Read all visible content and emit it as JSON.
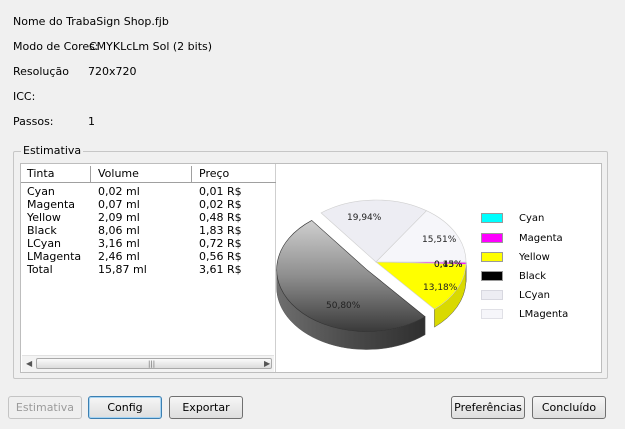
{
  "info": {
    "name_label": "Nome do TrabaSign Shop.fjb",
    "mode_label": "Modo de Cores:",
    "mode_value": "CMYKLcLm Sol (2 bits)",
    "resolution_label": "Resolução",
    "resolution_value": "720x720",
    "icc_label": "ICC:",
    "passes_label": "Passos:",
    "passes_value": "1"
  },
  "group": {
    "title": "Estimativa"
  },
  "table": {
    "headers": [
      "Tinta",
      "Volume",
      "Preço"
    ],
    "rows": [
      [
        "Cyan",
        "0,02 ml",
        "0,01 R$"
      ],
      [
        "Magenta",
        "0,07 ml",
        "0,02 R$"
      ],
      [
        "Yellow",
        "2,09 ml",
        "0,48 R$"
      ],
      [
        "Black",
        "8,06 ml",
        "1,83 R$"
      ],
      [
        "LCyan",
        "3,16 ml",
        "0,72 R$"
      ],
      [
        "LMagenta",
        "2,46 ml",
        "0,56 R$"
      ],
      [
        "Total",
        "15,87 ml",
        "3,61 R$"
      ]
    ]
  },
  "chart_data": {
    "type": "pie",
    "slices": [
      {
        "name": "Cyan",
        "value": 0.13,
        "color": "#00ffff"
      },
      {
        "name": "Magenta",
        "value": 0.45,
        "color": "#ff00ff"
      },
      {
        "name": "Yellow",
        "value": 13.18,
        "color": "#ffff00"
      },
      {
        "name": "Black",
        "value": 50.8,
        "color": "#000000"
      },
      {
        "name": "LCyan",
        "value": 19.94,
        "color": "#ededf3"
      },
      {
        "name": "LMagenta",
        "value": 15.51,
        "color": "#f6f6fa"
      }
    ],
    "labels": {
      "lcyan": "19,94%",
      "lmagenta": "15,51%",
      "magenta": "0,45%",
      "cyan": "0,13%",
      "yellow": "13,18%",
      "black": "50,80%"
    },
    "legend": [
      "Cyan",
      "Magenta",
      "Yellow",
      "Black",
      "LCyan",
      "LMagenta"
    ],
    "legend_position": "right"
  },
  "buttons": {
    "estimate": "Estimativa",
    "config": "Config",
    "export": "Exportar",
    "prefs": "Preferências",
    "done": "Concluído"
  }
}
